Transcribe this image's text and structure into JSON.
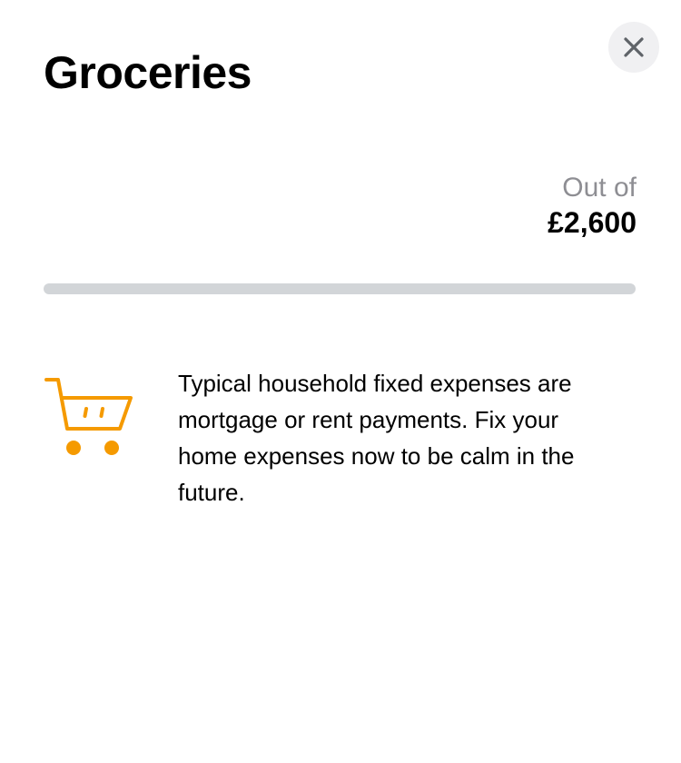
{
  "modal": {
    "title": "Groceries",
    "close_icon": "close-icon"
  },
  "budget": {
    "label": "Out of",
    "amount": "£2,600",
    "progress": 0
  },
  "info": {
    "icon": "shopping-cart-icon",
    "text": "Typical household fixed expenses are mortgage or rent payments. Fix your home expenses now to be calm in the future."
  },
  "colors": {
    "accent": "#f59a00",
    "track": "#d2d5d8",
    "muted_text": "#8e8e93",
    "close_bg": "#f0f0f2",
    "close_icon": "#5f6368"
  }
}
